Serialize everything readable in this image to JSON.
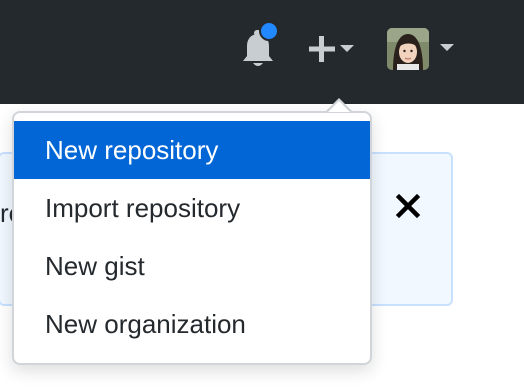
{
  "colors": {
    "header_bg": "#24292e",
    "accent": "#0366d6",
    "notification_dot": "#2188ff",
    "flash_bg": "#f1f8ff",
    "flash_border": "#c8e1ff"
  },
  "header": {
    "icons": [
      "bell-icon",
      "plus-icon",
      "chevron-down-icon",
      "avatar",
      "chevron-down-icon"
    ]
  },
  "flash": {
    "partial_text": "re",
    "close_icon": "close-icon"
  },
  "create_menu": {
    "items": [
      {
        "label": "New repository",
        "active": true
      },
      {
        "label": "Import repository",
        "active": false
      },
      {
        "label": "New gist",
        "active": false
      },
      {
        "label": "New organization",
        "active": false
      }
    ]
  }
}
